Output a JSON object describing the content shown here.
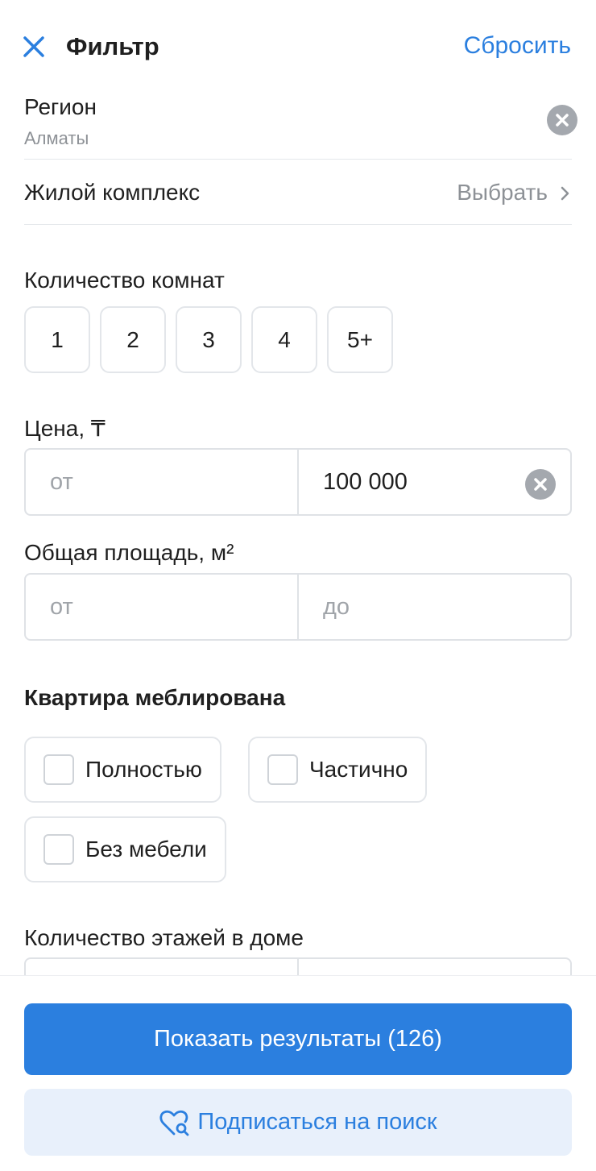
{
  "header": {
    "title": "Фильтр",
    "reset_label": "Сбросить",
    "close_icon": "close-icon"
  },
  "region": {
    "label": "Регион",
    "value": "Алматы"
  },
  "complex": {
    "label": "Жилой комплекс",
    "action": "Выбрать"
  },
  "rooms": {
    "label": "Количество комнат",
    "options": [
      "1",
      "2",
      "3",
      "4",
      "5+"
    ]
  },
  "price": {
    "label": "Цена, ₸",
    "from_placeholder": "от",
    "to_value": "100 000"
  },
  "area": {
    "label": "Общая площадь, м²",
    "from_placeholder": "от",
    "to_placeholder": "до"
  },
  "furnished": {
    "label": "Квартира меблирована",
    "options": [
      "Полностью",
      "Частично",
      "Без мебели"
    ]
  },
  "floors": {
    "label": "Количество этажей в доме"
  },
  "footer": {
    "show_results": "Показать результаты (126)",
    "subscribe": "Подписаться на поиск"
  },
  "colors": {
    "accent": "#2b7fdf",
    "subscribe_bg": "#e8f0fb",
    "muted": "#8d9196"
  }
}
